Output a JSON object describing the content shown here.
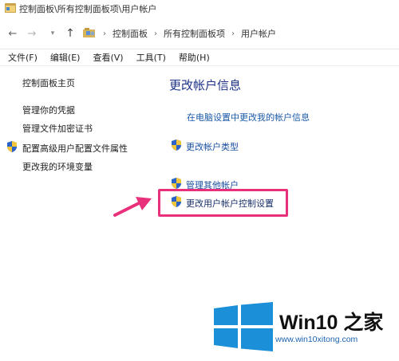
{
  "window": {
    "title": "控制面板\\所有控制面板项\\用户帐户"
  },
  "address_bar": {
    "crumbs": [
      "控制面板",
      "所有控制面板项",
      "用户帐户"
    ]
  },
  "menu": {
    "items": [
      "文件(F)",
      "编辑(E)",
      "查看(V)",
      "工具(T)",
      "帮助(H)"
    ]
  },
  "sidebar": {
    "home": "控制面板主页",
    "links": [
      "管理你的凭据",
      "管理文件加密证书",
      "配置高级用户配置文件属性",
      "更改我的环境变量"
    ]
  },
  "main": {
    "heading": "更改帐户信息",
    "pc_settings_link": "在电脑设置中更改我的帐户信息",
    "change_account_type": "更改帐户类型",
    "manage_other_accounts": "管理其他帐户",
    "uac_settings": "更改用户帐户控制设置"
  },
  "watermark": {
    "brand": "Win10 之家",
    "url": "www.win10xitong.com"
  },
  "colors": {
    "highlight": "#e8307b",
    "link": "#1a5aa8",
    "heading": "#1e3287",
    "win_logo": "#1b8fd8"
  },
  "icons": {
    "shield": "uac-shield-icon",
    "folder": "control-panel-folder-icon"
  }
}
